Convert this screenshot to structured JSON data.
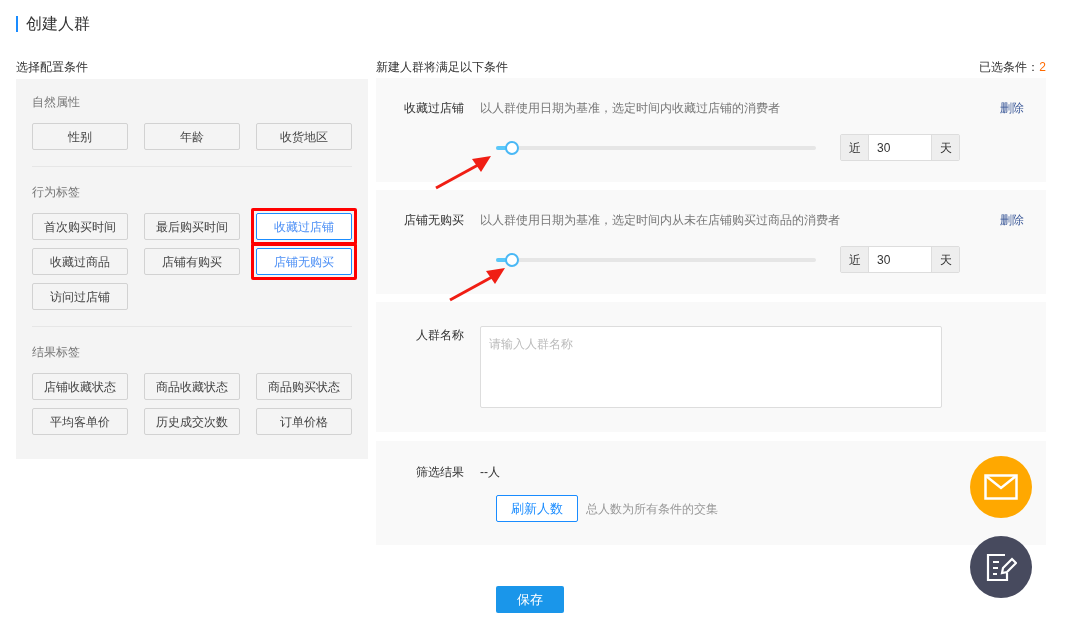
{
  "page_title": "创建人群",
  "left": {
    "heading": "选择配置条件",
    "groups": [
      {
        "title": "自然属性",
        "tags": [
          {
            "label": "性别",
            "selected": false,
            "annotated": false
          },
          {
            "label": "年龄",
            "selected": false,
            "annotated": false
          },
          {
            "label": "收货地区",
            "selected": false,
            "annotated": false
          }
        ]
      },
      {
        "title": "行为标签",
        "tags": [
          {
            "label": "首次购买时间",
            "selected": false,
            "annotated": false
          },
          {
            "label": "最后购买时间",
            "selected": false,
            "annotated": false
          },
          {
            "label": "收藏过店铺",
            "selected": true,
            "annotated": true
          },
          {
            "label": "收藏过商品",
            "selected": false,
            "annotated": false
          },
          {
            "label": "店铺有购买",
            "selected": false,
            "annotated": false
          },
          {
            "label": "店铺无购买",
            "selected": true,
            "annotated": true
          },
          {
            "label": "访问过店铺",
            "selected": false,
            "annotated": false
          }
        ]
      },
      {
        "title": "结果标签",
        "tags": [
          {
            "label": "店铺收藏状态",
            "selected": false,
            "annotated": false
          },
          {
            "label": "商品收藏状态",
            "selected": false,
            "annotated": false
          },
          {
            "label": "商品购买状态",
            "selected": false,
            "annotated": false
          },
          {
            "label": "平均客单价",
            "selected": false,
            "annotated": false
          },
          {
            "label": "历史成交次数",
            "selected": false,
            "annotated": false
          },
          {
            "label": "订单价格",
            "selected": false,
            "annotated": false
          }
        ]
      }
    ]
  },
  "right": {
    "heading": "新建人群将满足以下条件",
    "selected_count_label": "已选条件：",
    "selected_count": "2",
    "conditions": [
      {
        "name": "收藏过店铺",
        "description": "以人群使用日期为基准，选定时间内收藏过店铺的消费者",
        "delete": "删除",
        "level": 0.05,
        "prefix": "近",
        "value": "30",
        "suffix": "天",
        "arrow": true
      },
      {
        "name": "店铺无购买",
        "description": "以人群使用日期为基准，选定时间内从未在店铺购买过商品的消费者",
        "delete": "删除",
        "level": 0.05,
        "prefix": "近",
        "value": "30",
        "suffix": "天",
        "arrow": true
      }
    ],
    "name_field": {
      "label": "人群名称",
      "placeholder": "请输入人群名称"
    },
    "result": {
      "label": "筛选结果",
      "value": "--人",
      "refresh_button": "刷新人数",
      "hint": "总人数为所有条件的交集"
    },
    "save_button": "保存"
  }
}
